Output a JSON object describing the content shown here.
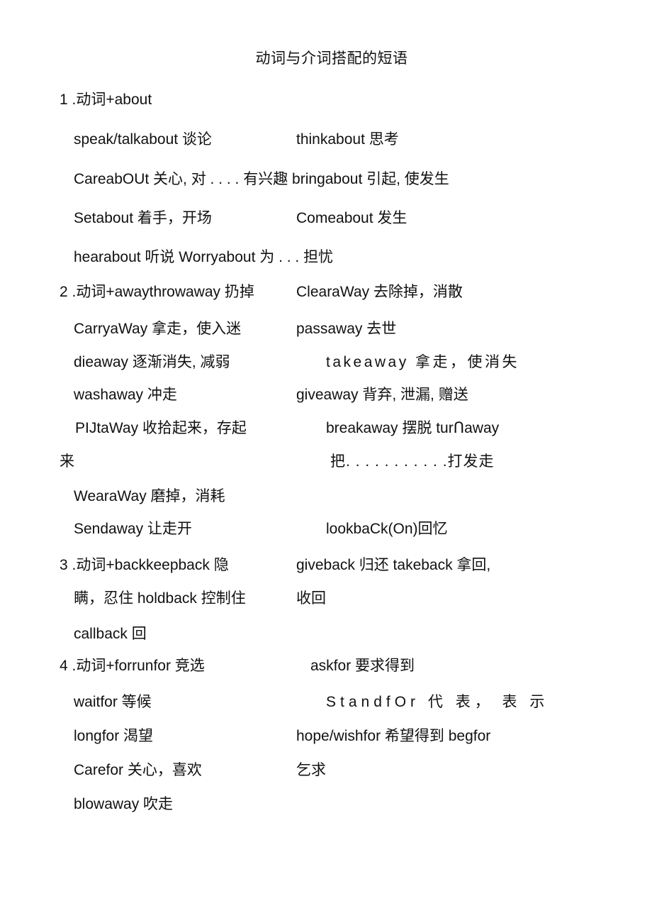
{
  "document": {
    "title": "动词与介词搭配的短语",
    "sections": [
      {
        "number": "1",
        "heading": "1 .动词+about",
        "lines": [
          {
            "col1": "speak/talkabout 谈论",
            "col2": "thinkabout 思考"
          },
          {
            "col1": "CareabOUt 关心, 对 . . . . 有兴趣 bringabout 引起, 使发生",
            "col2": ""
          },
          {
            "col1": "Setabout 着手，开场",
            "col2": "Comeabout 发生"
          },
          {
            "col1": "hearabout 听说 Worryabout 为 . . . 担忧",
            "col2": ""
          }
        ]
      },
      {
        "number": "2",
        "heading": "2 .动词+awaythrowaway 扔掉",
        "lines": [
          {
            "col1": "",
            "col2": "ClearaWay 去除掉，消散"
          },
          {
            "col1": "CarryaWay 拿走，使入迷",
            "col2": "passaway 去世"
          },
          {
            "col1": "dieaway 逐渐消失, 减弱",
            "col2": "takeaway 拿 走， 使 消 失"
          },
          {
            "col1": "washaway 冲走",
            "col2": "giveaway 背弃, 泄漏, 赠送"
          },
          {
            "col1": "PIJtaWay 收拾起来，存起",
            "col2": "breakaway 摆脱 turՈaway"
          },
          {
            "col1": "来",
            "col2": "把. . . . . . . . . . .打发走"
          },
          {
            "col1": "WearaWay 磨掉，消耗",
            "col2": ""
          },
          {
            "col1": "Sendaway 让走开",
            "col2": "lookbaCk(On)回忆"
          }
        ]
      },
      {
        "number": "3",
        "heading": "3 .动词+backkeepback 隐",
        "lines": [
          {
            "col1": "",
            "col2": "giveback 归还 takeback 拿回,"
          },
          {
            "col1": "瞒，忍住 holdback 控制住",
            "col2": "收回"
          },
          {
            "col1": "callback 回",
            "col2": ""
          }
        ]
      },
      {
        "number": "4",
        "heading": "4 .动词+forrunfor 竞选",
        "lines": [
          {
            "col1": "",
            "col2": "askfor 要求得到"
          },
          {
            "col1": "waitfor 等候",
            "col2": "StandfOr 代 表， 表 示"
          },
          {
            "col1": "longfor 渴望",
            "col2": "hope/wishfor 希望得到 begfor"
          },
          {
            "col1": "Carefor 关心，喜欢",
            "col2": "乞求"
          },
          {
            "col1": "blowaway 吹走",
            "col2": ""
          }
        ]
      }
    ],
    "text_lines": {
      "title": "动词与介词搭配的短语",
      "l01": "1 .动词+about",
      "l02": "speak/talkabout 谈论",
      "l03": "thinkabout 思考",
      "l04": "CareabOUt 关心, 对 . . . . 有兴趣 bringabout 引起, 使发生",
      "l05": "Setabout 着手，开场",
      "l06": "Comeabout 发生",
      "l07": "hearabout 听说 Worryabout 为 . . . 担忧",
      "l08": "2 .动词+awaythrowaway 扔掉",
      "l09": "ClearaWay 去除掉，消散",
      "l10": "CarryaWay 拿走，使入迷",
      "l11": "passaway 去世",
      "l12": "dieaway 逐渐消失, 减弱",
      "l13": "takeaway 拿走，使消失",
      "l14": "washaway 冲走",
      "l15": "giveaway 背弃, 泄漏, 赠送",
      "l16": "PIJtaWay 收拾起来，存起",
      "l17": "breakaway 摆脱 turՈaway",
      "l18": "来",
      "l19": "把. . . . . . . . . . .打发走",
      "l20": "WearaWay 磨掉，消耗",
      "l21": "Sendaway 让走开",
      "l22": "lookbaCk(On)回忆",
      "l23": "3 .动词+backkeepback 隐",
      "l24": "giveback 归还 takeback 拿回,",
      "l25": "瞒，忍住 holdback 控制住",
      "l26": "收回",
      "l27": "callback 回",
      "l28": "4 .动词+forrunfor 竞选",
      "l29": "askfor 要求得到",
      "l30": "waitfor 等候",
      "l31": "StandfOr 代 表， 表 示",
      "l32": "longfor 渴望",
      "l33": "hope/wishfor 希望得到 begfor",
      "l34": "Carefor 关心，喜欢",
      "l35": "乞求",
      "l36": "blowaway 吹走"
    }
  }
}
